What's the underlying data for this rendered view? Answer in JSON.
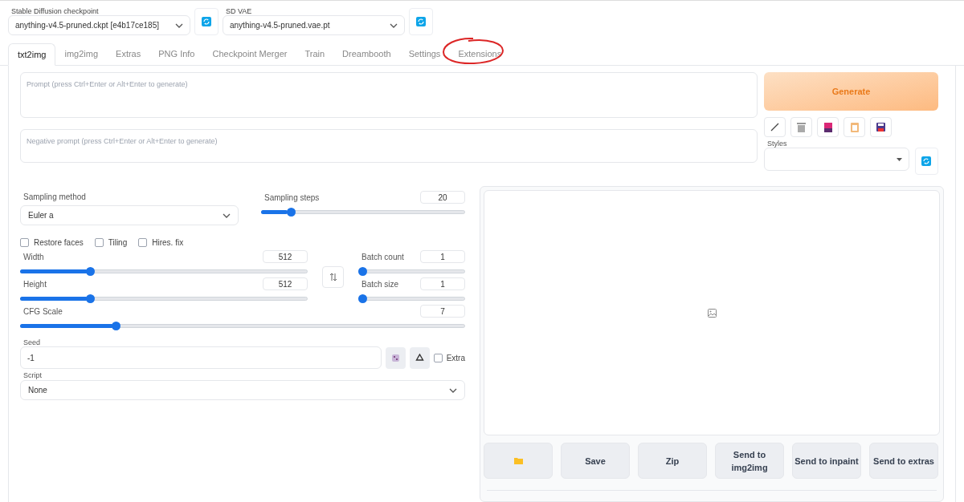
{
  "checkpoint": {
    "label": "Stable Diffusion checkpoint",
    "value": "anything-v4.5-pruned.ckpt [e4b17ce185]"
  },
  "vae": {
    "label": "SD VAE",
    "value": "anything-v4.5-pruned.vae.pt"
  },
  "tabs": [
    {
      "label": "txt2img",
      "selected": true
    },
    {
      "label": "img2img",
      "selected": false
    },
    {
      "label": "Extras",
      "selected": false
    },
    {
      "label": "PNG Info",
      "selected": false
    },
    {
      "label": "Checkpoint Merger",
      "selected": false
    },
    {
      "label": "Train",
      "selected": false
    },
    {
      "label": "Dreambooth",
      "selected": false
    },
    {
      "label": "Settings",
      "selected": false
    },
    {
      "label": "Extensions",
      "selected": false,
      "circled": true
    }
  ],
  "prompt": {
    "placeholder": "Prompt (press Ctrl+Enter or Alt+Enter to generate)"
  },
  "negative_prompt": {
    "placeholder": "Negative prompt (press Ctrl+Enter or Alt+Enter to generate)"
  },
  "generate_button": "Generate",
  "styles": {
    "label": "Styles"
  },
  "sampling_method": {
    "label": "Sampling method",
    "value": "Euler a"
  },
  "sampling_steps": {
    "label": "Sampling steps",
    "value": "20",
    "level": 0.13
  },
  "checkboxes": [
    {
      "label": "Restore faces",
      "checked": false
    },
    {
      "label": "Tiling",
      "checked": false
    },
    {
      "label": "Hires. fix",
      "checked": false
    }
  ],
  "width": {
    "label": "Width",
    "value": "512",
    "level": 0.235
  },
  "height": {
    "label": "Height",
    "value": "512",
    "level": 0.235
  },
  "batch_count": {
    "label": "Batch count",
    "value": "1",
    "level": 0
  },
  "batch_size": {
    "label": "Batch size",
    "value": "1",
    "level": 0
  },
  "cfg_scale": {
    "label": "CFG Scale",
    "value": "7",
    "level": 0.21
  },
  "seed": {
    "label": "Seed",
    "value": "-1",
    "extra": {
      "label": "Extra",
      "checked": false
    }
  },
  "script": {
    "label": "Script",
    "value": "None"
  },
  "output_buttons": [
    {
      "kind": "folder"
    },
    {
      "kind": "text",
      "label": "Save"
    },
    {
      "kind": "text",
      "label": "Zip"
    },
    {
      "kind": "text",
      "label": "Send to img2img"
    },
    {
      "kind": "text",
      "label": "Send to inpaint"
    },
    {
      "kind": "text",
      "label": "Send to extras"
    }
  ]
}
